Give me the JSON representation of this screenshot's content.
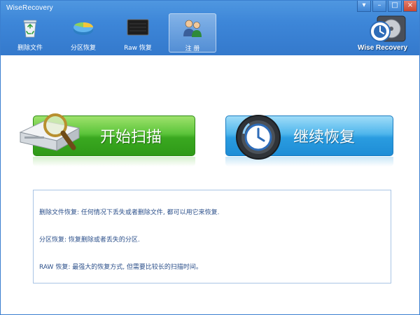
{
  "window": {
    "title": "WiseRecovery"
  },
  "titlebar": {
    "controls": [
      "▾",
      "–",
      "□",
      "×"
    ]
  },
  "tabs": [
    {
      "label": "删除文件",
      "icon": "recycle-bin-icon"
    },
    {
      "label": "分区恢复",
      "icon": "partition-pie-icon"
    },
    {
      "label": "Raw 恢复",
      "icon": "raw-screen-icon"
    },
    {
      "label": "注 册",
      "icon": "users-register-icon"
    }
  ],
  "brand": {
    "name": "Wise Recovery"
  },
  "actions": {
    "scan_label": "开始扫描",
    "resume_label": "继续恢复"
  },
  "info": {
    "lines": [
      "删除文件恢复: 任何情况下丢失或者删除文件, 都可以用它来恢复.",
      "分区恢复: 恢复删除或者丢失的分区.",
      "RAW 恢复: 最强大的恢复方式, 但需要比较长的扫描时间。"
    ]
  },
  "colors": {
    "titlebar": "#3d86d8",
    "scan_green": "#3aa820",
    "resume_blue": "#2a9ce0",
    "info_text": "#2b4f8a"
  }
}
